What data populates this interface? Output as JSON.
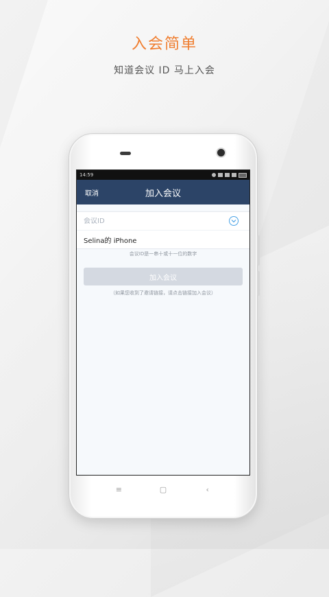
{
  "hero": {
    "title": "入会简单",
    "subtitle": "知道会议 ID 马上入会"
  },
  "statusbar": {
    "time": "14:59"
  },
  "navbar": {
    "cancel_label": "取消",
    "title": "加入会议"
  },
  "form": {
    "meeting_id_placeholder": "会议ID",
    "meeting_id_value": "",
    "dropdown_icon": "chevron-down-circle-icon",
    "display_name_value": "Selina的 iPhone",
    "id_hint": "会议ID是一串十或十一位的数字",
    "join_button_label": "加入会议",
    "link_hint": "（如果您收到了邀请链接，请点击链接加入会议）"
  },
  "softkeys": {
    "menu": "≡",
    "home": "▢",
    "back": "‹"
  },
  "colors": {
    "accent_orange": "#f07d2e",
    "navbar": "#2c4467",
    "disabled_button": "#d4d9e1",
    "link_blue": "#4aa3e6"
  }
}
